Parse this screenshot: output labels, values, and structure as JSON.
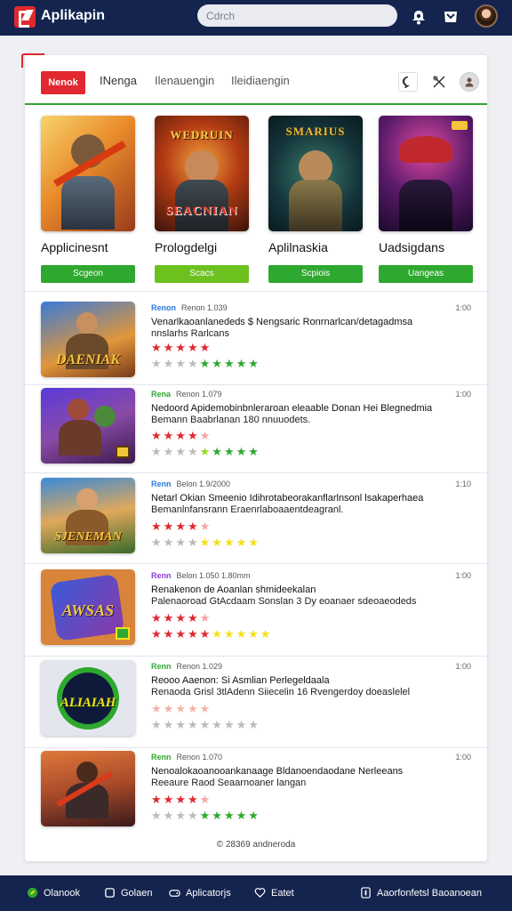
{
  "header": {
    "app_title": "Aplikapin",
    "search_placeholder": "Cdrch"
  },
  "tabs": [
    {
      "label": "Nenok",
      "active": true
    },
    {
      "label": "INenga",
      "active": false
    },
    {
      "label": "Ilenauengin",
      "active": false
    },
    {
      "label": "Ileidiaengin",
      "active": false
    }
  ],
  "featured": [
    {
      "name": "Applicinesnt",
      "button": "Scgeon",
      "banner": "",
      "button_color": "#2ea82e"
    },
    {
      "name": "Prologdelgi",
      "button": "Scacs",
      "banner": "SEACNIAN",
      "top_banner": "WEDRUIN",
      "button_color": "#6cc11f"
    },
    {
      "name": "Aplilnaskia",
      "button": "Scpiois",
      "banner": "",
      "top_banner": "SMARIUS",
      "button_color": "#2ea82e"
    },
    {
      "name": "Uadsigdans",
      "button": "Uangeas",
      "banner": "",
      "button_color": "#2ea82e"
    }
  ],
  "list": [
    {
      "tag": "Renon",
      "tag_color": "#2a7bd8",
      "meta": "Renon 1.039",
      "time": "1:00",
      "title": "Venarlkaoanlanededs $ Nengsaric Ronrnarlcan/detagadmsa",
      "subtitle": "nnslarhs Rarlcans",
      "stars1": [
        "#e0282e",
        "#e0282e",
        "#e0282e",
        "#e0282e",
        "#e0282e"
      ],
      "stars2": [
        "#bbbbbb",
        "#bbbbbb",
        "#bbbbbb",
        "#bbbbbb",
        "#2ea82e",
        "#2ea82e",
        "#2ea82e",
        "#2ea82e",
        "#2ea82e"
      ],
      "thumb": "DAENIAK"
    },
    {
      "tag": "Rena",
      "tag_color": "#2ea82e",
      "meta": "Renon 1.079",
      "time": "1:00",
      "title": "Nedoord Apidemobinbnleraroan eleaable Donan Hei Blegnedmia",
      "subtitle": "Bemann Baabrlanan 180 nnuuodets.",
      "stars1": [
        "#e0282e",
        "#e0282e",
        "#e0282e",
        "#e0282e",
        "#f4a6a6"
      ],
      "stars2": [
        "#bbbbbb",
        "#bbbbbb",
        "#bbbbbb",
        "#bbbbbb",
        "#9ad62a",
        "#2ea82e",
        "#2ea82e",
        "#2ea82e",
        "#2ea82e"
      ],
      "thumb": ""
    },
    {
      "tag": "Renn",
      "tag_color": "#2a7bd8",
      "meta": "Belon 1.9/2000",
      "time": "1:10",
      "title": "Netarl Okian Smeenio Idihrotabeorakanflarlnsonl lsakaperhaea",
      "subtitle": "Bemanlnfansrann Eraenrlaboaaentdeagranl.",
      "stars1": [
        "#e0282e",
        "#e0282e",
        "#e0282e",
        "#e0282e",
        "#f4a6a6"
      ],
      "stars2": [
        "#bbbbbb",
        "#bbbbbb",
        "#bbbbbb",
        "#bbbbbb",
        "#f2e01a",
        "#f2e01a",
        "#f2e01a",
        "#f2e01a",
        "#f2e01a"
      ],
      "thumb": "SJENEMAN"
    },
    {
      "tag": "Renn",
      "tag_color": "#8b3ad8",
      "meta": "Belon 1.050 1.80mm",
      "time": "1:00",
      "title": "Renakenon de Aoanlan shmideekalan",
      "subtitle": "Palenaoroad GtAcdaam Sonslan 3 Dy eoanaer sdeoaeodeds",
      "stars1": [
        "#e0282e",
        "#e0282e",
        "#e0282e",
        "#e0282e",
        "#f4a6a6"
      ],
      "stars2": [
        "#e0282e",
        "#e0282e",
        "#e0282e",
        "#e0282e",
        "#e0282e",
        "#f2e01a",
        "#f2e01a",
        "#f2e01a",
        "#f2e01a",
        "#f2e01a"
      ],
      "thumb": "AWSAS"
    },
    {
      "tag": "Renn",
      "tag_color": "#2ea82e",
      "meta": "Renon 1.029",
      "time": "1:00",
      "title": "Reooo Aaenon: Si Asmlian Perlegeldaala",
      "subtitle": "Renaoda Grisl 3tlAdenn Siiecelin 16 Rvengerdoy doeaslelel",
      "stars1": [
        "#f4b3a8",
        "#f4b3a8",
        "#f4b3a8",
        "#f4b3a8",
        "#f4b3a8"
      ],
      "stars2": [
        "#bbbbbb",
        "#bbbbbb",
        "#bbbbbb",
        "#bbbbbb",
        "#bbbbbb",
        "#bbbbbb",
        "#bbbbbb",
        "#bbbbbb",
        "#bbbbbb"
      ],
      "thumb": "ALIAIAH"
    },
    {
      "tag": "Renn",
      "tag_color": "#2ea82e",
      "meta": "Renon 1.070",
      "time": "1:00",
      "title": "Nenoalokaoanooankanaage Bldanoendaodane Nerleeans",
      "subtitle": "Reeaure Raod Seaarnoaner langan",
      "stars1": [
        "#e0282e",
        "#e0282e",
        "#e0282e",
        "#e0282e",
        "#f4a6a6"
      ],
      "stars2": [
        "#bbbbbb",
        "#bbbbbb",
        "#bbbbbb",
        "#bbbbbb",
        "#2ea82e",
        "#2ea82e",
        "#2ea82e",
        "#2ea82e",
        "#2ea82e"
      ],
      "thumb": ""
    }
  ],
  "footer_note": "© 28369 andneroda",
  "bottom_nav": [
    {
      "label": "Olanook",
      "icon": "leaf-icon"
    },
    {
      "label": "Golaen",
      "icon": "square-icon"
    },
    {
      "label": "Aplicatorjs",
      "icon": "gamepad-icon"
    },
    {
      "label": "Eatet",
      "icon": "heart-icon"
    },
    {
      "label": "Aaorfonfetsl Baoanoean",
      "icon": "info-icon"
    }
  ]
}
